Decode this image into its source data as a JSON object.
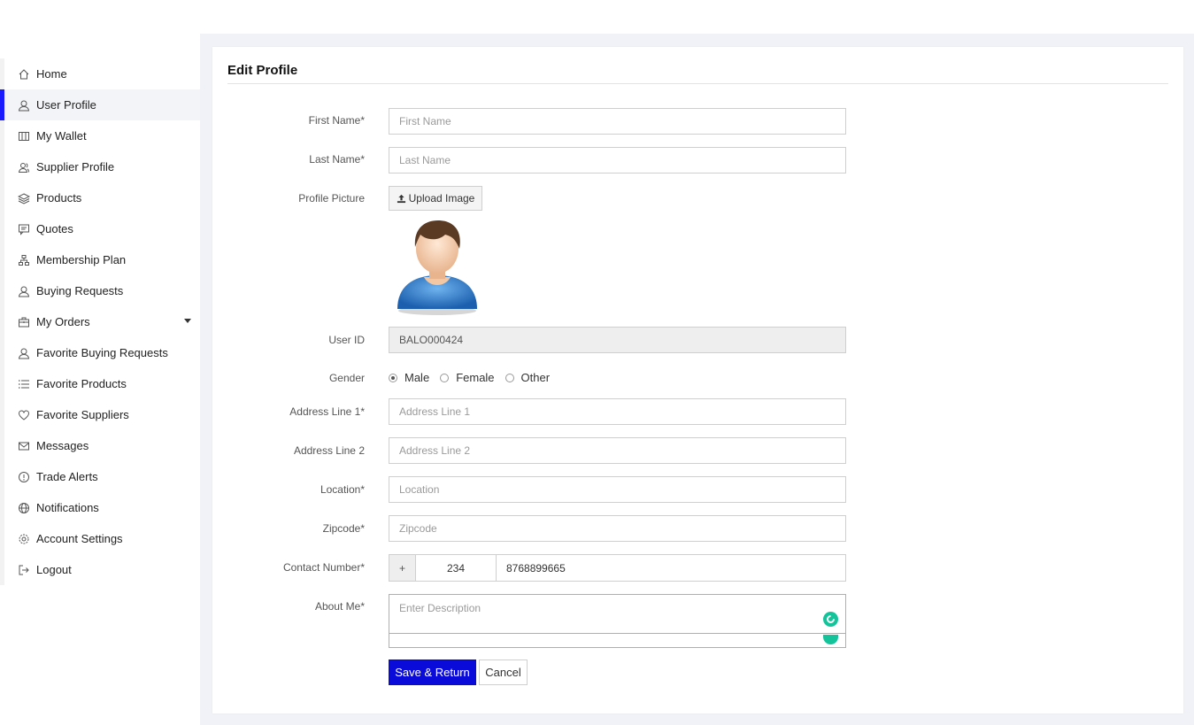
{
  "sidebar": {
    "items": [
      {
        "label": "Home",
        "icon": "home-icon"
      },
      {
        "label": "User Profile",
        "icon": "user-icon",
        "active": true
      },
      {
        "label": "My Wallet",
        "icon": "wallet-icon"
      },
      {
        "label": "Supplier Profile",
        "icon": "users-icon"
      },
      {
        "label": "Products",
        "icon": "layers-icon"
      },
      {
        "label": "Quotes",
        "icon": "message-icon"
      },
      {
        "label": "Membership Plan",
        "icon": "sitemap-icon"
      },
      {
        "label": "Buying Requests",
        "icon": "user-icon"
      },
      {
        "label": "My Orders",
        "icon": "briefcase-icon",
        "has_caret": true
      },
      {
        "label": "Favorite Buying Requests",
        "icon": "user-icon"
      },
      {
        "label": "Favorite Products",
        "icon": "list-icon"
      },
      {
        "label": "Favorite Suppliers",
        "icon": "heart-icon"
      },
      {
        "label": "Messages",
        "icon": "mail-icon"
      },
      {
        "label": "Trade Alerts",
        "icon": "alert-icon"
      },
      {
        "label": "Notifications",
        "icon": "globe-icon"
      },
      {
        "label": "Account Settings",
        "icon": "gear-icon"
      },
      {
        "label": "Logout",
        "icon": "logout-icon"
      }
    ]
  },
  "form": {
    "title": "Edit Profile",
    "first_name": {
      "label": "First Name*",
      "placeholder": "First Name",
      "value": ""
    },
    "last_name": {
      "label": "Last Name*",
      "placeholder": "Last Name",
      "value": ""
    },
    "profile_picture": {
      "label": "Profile Picture",
      "button": "Upload Image"
    },
    "user_id": {
      "label": "User ID",
      "value": "BALO000424"
    },
    "gender": {
      "label": "Gender",
      "options": [
        "Male",
        "Female",
        "Other"
      ],
      "selected": "Male"
    },
    "address1": {
      "label": "Address Line 1*",
      "placeholder": "Address Line 1"
    },
    "address2": {
      "label": "Address Line 2",
      "placeholder": "Address Line 2"
    },
    "location": {
      "label": "Location*",
      "placeholder": "Location"
    },
    "zipcode": {
      "label": "Zipcode*",
      "placeholder": "Zipcode"
    },
    "contact": {
      "label": "Contact Number*",
      "prefix": "+",
      "code": "234",
      "number": "8768899665"
    },
    "about": {
      "label": "About Me*",
      "placeholder": "Enter Description"
    },
    "save_label": "Save & Return",
    "cancel_label": "Cancel"
  },
  "colors": {
    "accent": "#0b0bd9",
    "grammarly": "#15c39a",
    "active_bar": "#1a1aff"
  }
}
